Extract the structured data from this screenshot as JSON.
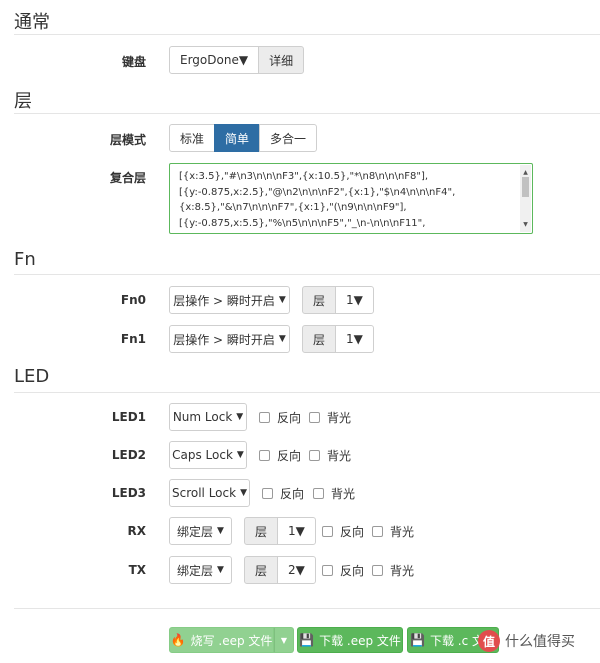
{
  "sections": {
    "general": "通常",
    "layer": "层",
    "fn": "Fn",
    "led": "LED"
  },
  "keyboard": {
    "label": "键盘",
    "value": "ErgoDone",
    "detail": "详细"
  },
  "layer_mode": {
    "label": "层模式",
    "options": [
      "标准",
      "简单",
      "多合一"
    ],
    "active": "简单"
  },
  "composite": {
    "label": "复合层",
    "lines": [
      "[{x:3.5},\"#\\n3\\n\\n\\nF3\",{x:10.5},\"*\\n8\\n\\n\\nF8\"],",
      "[{y:-0.875,x:2.5},\"@\\n2\\n\\n\\nF2\",{x:1},\"$\\n4\\n\\n\\nF4\",",
      "{x:8.5},\"&\\n7\\n\\n\\nF7\",{x:1},\"(\\n9\\n\\n\\nF9\"],",
      "[{y:-0.875,x:5.5},\"%\\n5\\n\\n\\nF5\",\"_\\n-\\n\\n\\nF11\","
    ]
  },
  "fn_rows": [
    {
      "label": "Fn0",
      "action": "层操作 > 瞬时开启",
      "layer_label": "层",
      "layer_value": "1"
    },
    {
      "label": "Fn1",
      "action": "层操作 > 瞬时开启",
      "layer_label": "层",
      "layer_value": "1"
    }
  ],
  "led_rows": [
    {
      "label": "LED1",
      "select": "Num Lock",
      "reverse": "反向",
      "backlight": "背光"
    },
    {
      "label": "LED2",
      "select": "Caps Lock",
      "reverse": "反向",
      "backlight": "背光"
    },
    {
      "label": "LED3",
      "select": "Scroll Lock",
      "reverse": "反向",
      "backlight": "背光"
    },
    {
      "label": "RX",
      "select": "绑定层",
      "layer_label": "层",
      "layer_value": "1",
      "reverse": "反向",
      "backlight": "背光"
    },
    {
      "label": "TX",
      "select": "绑定层",
      "layer_label": "层",
      "layer_value": "2",
      "reverse": "反向",
      "backlight": "背光"
    }
  ],
  "actions": {
    "burn": "烧写 .eep 文件",
    "download_eep": "下载 .eep 文件",
    "download_c": "下载 .c 文件"
  },
  "watermark": {
    "logo_char": "值",
    "text": "什么值得买"
  },
  "colors": {
    "primary": "#2e6da4",
    "success": "#5cb85c",
    "success_light": "#91d191"
  },
  "icons": {
    "burn": "fire-icon",
    "download": "save-icon",
    "caret": "caret-down-icon"
  }
}
